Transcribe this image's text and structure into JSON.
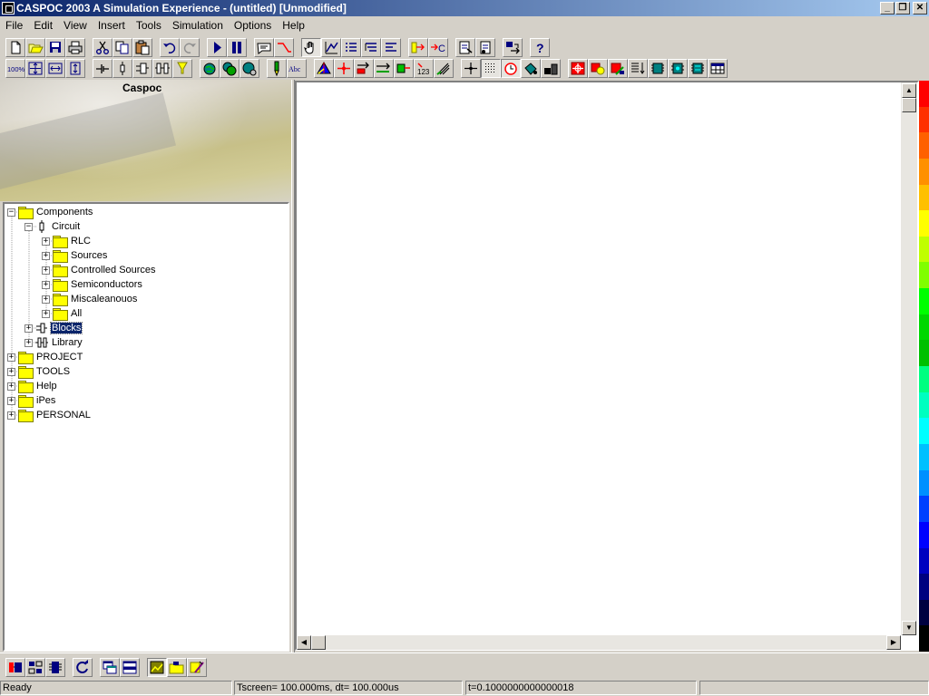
{
  "window": {
    "title": "CASPOC 2003 A Simulation Experience - (untitled) [Unmodified]",
    "caption_minimize": "_",
    "caption_restore": "❐",
    "caption_close": "✕"
  },
  "menu": [
    "File",
    "Edit",
    "View",
    "Insert",
    "Tools",
    "Simulation",
    "Options",
    "Help"
  ],
  "toolbar": {
    "zoom_label": "100%",
    "num_label": "123",
    "text_label": "Abc",
    "help_label": "?",
    "icons_row1": [
      "new-file-icon",
      "open-folder-icon",
      "save-icon",
      "print-icon",
      "cut-icon",
      "copy-icon",
      "paste-icon",
      "undo-icon",
      "redo-icon",
      "run-simulation-icon",
      "pause-icon",
      "comment-icon",
      "wire-icon",
      "hand-icon",
      "measure-icon",
      "list-icon",
      "list-tree-icon",
      "list-align-icon",
      "connect-in-icon",
      "connect-c-icon",
      "export-icon",
      "import-icon",
      "swap-icon",
      "help-icon"
    ],
    "icons_row2": [
      "zoom-100-icon",
      "zoom-fit-icon",
      "zoom-width-icon",
      "zoom-height-icon",
      "ground-node-icon",
      "resistor-icon",
      "block-icon",
      "block-pair-icon",
      "probe-icon",
      "globe-icon",
      "globe-double-icon",
      "globe-link-icon",
      "pen-icon",
      "text-icon",
      "prism-icon",
      "cross-red-icon",
      "arrow-block-icon",
      "arrow-right-icon",
      "green-block-icon",
      "counter-icon",
      "sweep-icon",
      "crosshair-icon",
      "grid-icon",
      "clock-icon",
      "fill-icon",
      "battery-icon",
      "target-icon",
      "component-icon",
      "edit-component-icon",
      "sort-icon",
      "chip-icon",
      "chip2-icon",
      "chip3-icon",
      "table-icon"
    ]
  },
  "brand": {
    "title": "Caspoc"
  },
  "tree": [
    {
      "label": "Components",
      "level": 0,
      "expander": "−",
      "icon": "folder"
    },
    {
      "label": "Circuit",
      "level": 1,
      "expander": "−",
      "icon": "circuit"
    },
    {
      "label": "RLC",
      "level": 2,
      "expander": "+",
      "icon": "folder"
    },
    {
      "label": "Sources",
      "level": 2,
      "expander": "+",
      "icon": "folder"
    },
    {
      "label": "Controlled Sources",
      "level": 2,
      "expander": "+",
      "icon": "folder"
    },
    {
      "label": "Semiconductors",
      "level": 2,
      "expander": "+",
      "icon": "folder"
    },
    {
      "label": "Miscaleanouos",
      "level": 2,
      "expander": "+",
      "icon": "folder"
    },
    {
      "label": "All",
      "level": 2,
      "expander": "+",
      "icon": "folder"
    },
    {
      "label": "Blocks",
      "level": 1,
      "expander": "+",
      "icon": "block",
      "selected": true
    },
    {
      "label": "Library",
      "level": 1,
      "expander": "+",
      "icon": "library"
    },
    {
      "label": "PROJECT",
      "level": 0,
      "expander": "+",
      "icon": "folder"
    },
    {
      "label": "TOOLS",
      "level": 0,
      "expander": "+",
      "icon": "folder"
    },
    {
      "label": "Help",
      "level": 0,
      "expander": "+",
      "icon": "folder"
    },
    {
      "label": "iPes",
      "level": 0,
      "expander": "+",
      "icon": "folder"
    },
    {
      "label": "PERSONAL",
      "level": 0,
      "expander": "+",
      "icon": "folder"
    }
  ],
  "scroll": {
    "up": "▲",
    "down": "▼",
    "left": "◀",
    "right": "▶"
  },
  "colorscale": [
    "#ff0000",
    "#ff3000",
    "#ff6000",
    "#ff9000",
    "#ffc000",
    "#ffff00",
    "#c0ff00",
    "#80ff00",
    "#00ff00",
    "#00d800",
    "#00c000",
    "#00ff80",
    "#00ffc0",
    "#00ffff",
    "#00c0ff",
    "#0090ff",
    "#0040ff",
    "#0000ff",
    "#0000c0",
    "#000080",
    "#000040",
    "#000000"
  ],
  "bottom_icons": [
    "circuit-editor-icon",
    "block-editor-icon",
    "chip-view-icon",
    "refresh-icon",
    "window-cascade-icon",
    "window-tile-icon",
    "scope-image-icon",
    "folder-image-icon",
    "edit-image-icon"
  ],
  "status": {
    "ready": "Ready",
    "timing": "Tscreen= 100.000ms, dt= 100.000us",
    "time": "t=0.1000000000000018"
  }
}
